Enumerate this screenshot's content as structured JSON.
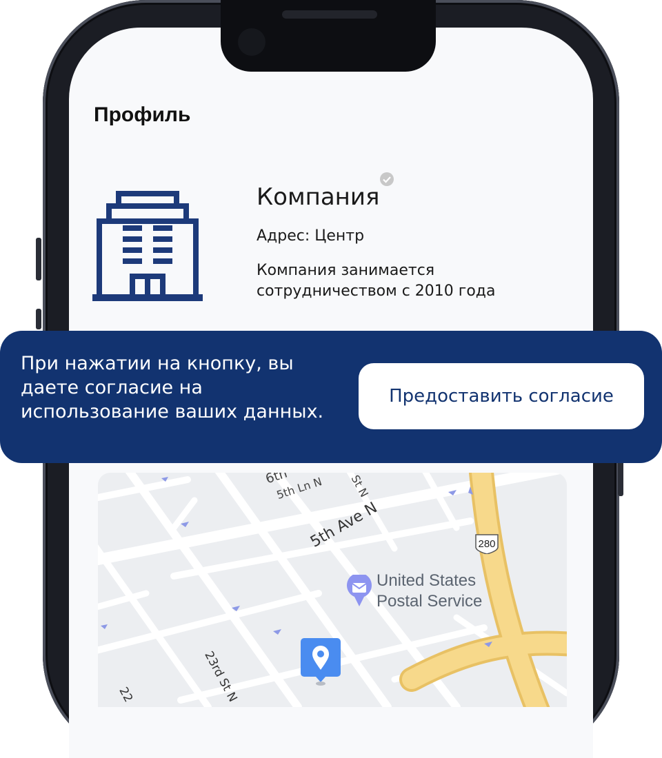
{
  "page": {
    "title": "Профиль"
  },
  "company": {
    "name": "Компания",
    "address": "Адрес: Центр",
    "description": "Компания занимается сотрудничеством с 2010 года"
  },
  "consent": {
    "text": "При нажатии на кнопку, вы даете согласие на использование ваших данных.",
    "button_label": "Предоставить согласие"
  },
  "map": {
    "street_labels": [
      "6th",
      "5th Ln N",
      "St N",
      "5th Ave N",
      "23rd St N",
      "22"
    ],
    "highway_number": "280",
    "poi": {
      "name_line1": "United States",
      "name_line2": "Postal Service",
      "icon": "mail-icon"
    }
  },
  "colors": {
    "brand": "#123370",
    "icon_blue": "#1d3a7a",
    "highway": "#f7d98b",
    "pin": "#4a8cf0",
    "poi_icon": "#8d94f0"
  }
}
